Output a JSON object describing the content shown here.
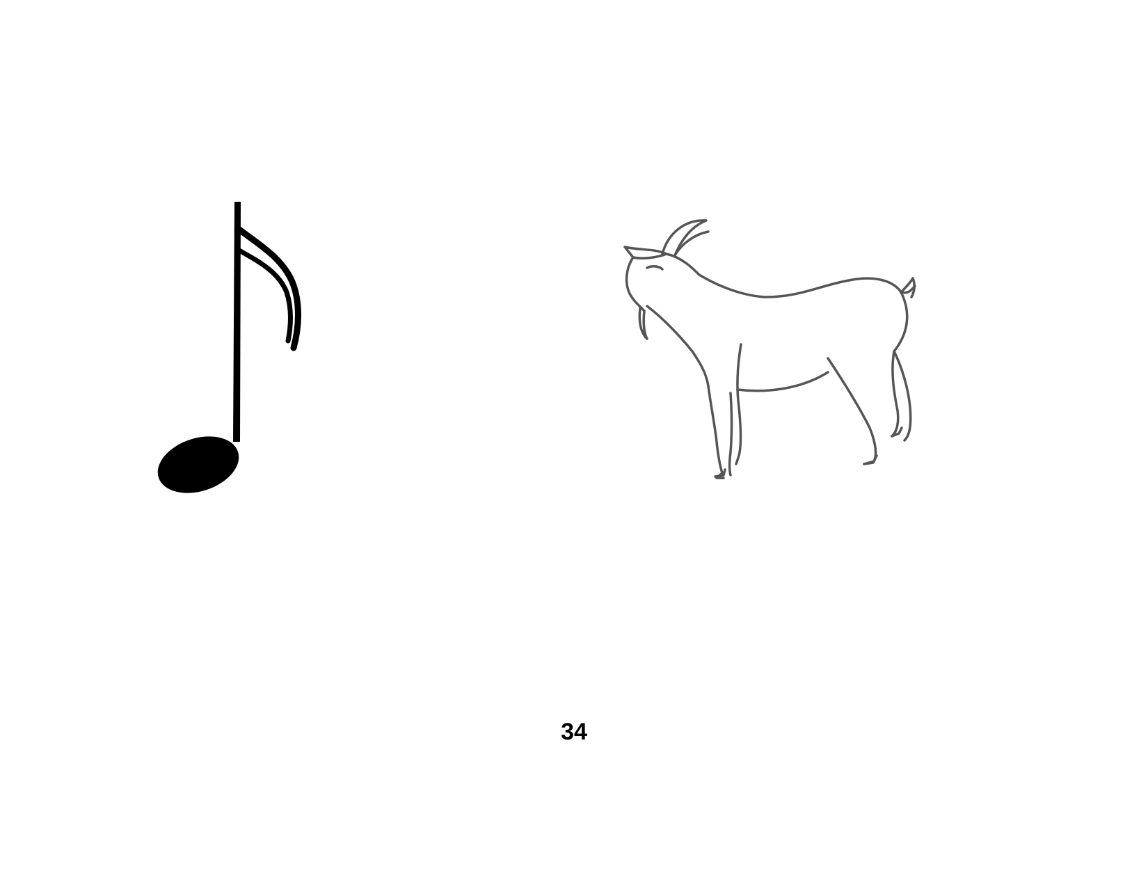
{
  "page": {
    "page_number": "34"
  },
  "figures": {
    "left_icon": "eighth-note-icon",
    "right_icon": "goat-icon"
  },
  "colors": {
    "background": "#ffffff",
    "note_fill": "#000000",
    "goat_stroke": "#555555",
    "page_number": "#000000"
  }
}
